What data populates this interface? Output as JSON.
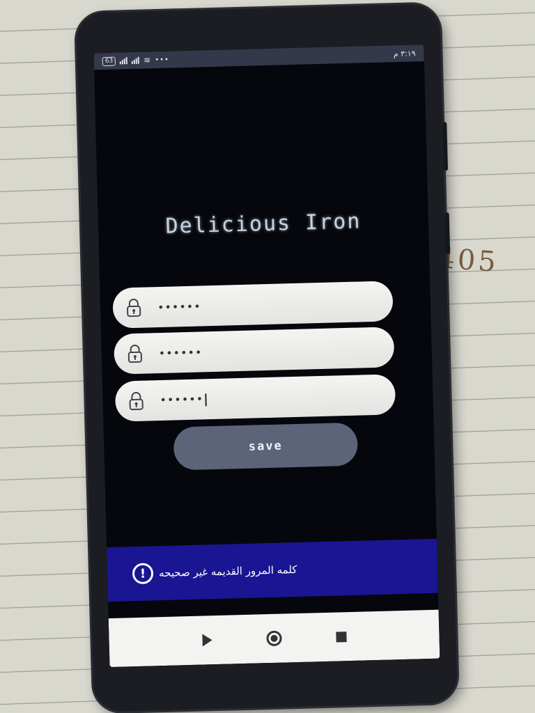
{
  "statusbar": {
    "battery": "63",
    "time": "٣:١٩ م"
  },
  "app": {
    "title": "Delicious Iron"
  },
  "fields": [
    {
      "value": "••••••"
    },
    {
      "value": "••••••"
    },
    {
      "value": "••••••"
    }
  ],
  "save_button": {
    "label": "save"
  },
  "snackbar": {
    "message": "كلمه المرور القديمه غير صحيحه"
  },
  "paper_note": "9405",
  "icons": {
    "field_icon": "lock-icon",
    "alert_icon": "exclamation-circle-icon",
    "nav": [
      "back-icon",
      "home-icon",
      "recents-icon"
    ]
  },
  "colors": {
    "screen_bg": "#06070d",
    "button": "#5c6479",
    "snackbar": "#1a1593",
    "field": "#f0f0ee"
  }
}
